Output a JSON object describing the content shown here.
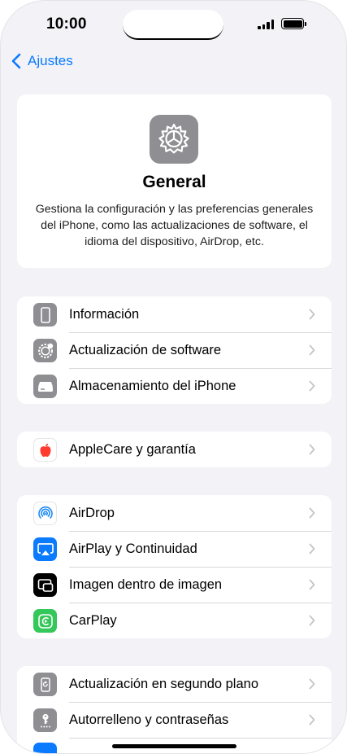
{
  "status_bar": {
    "time": "10:00"
  },
  "nav": {
    "back_label": "Ajustes"
  },
  "header": {
    "title": "General",
    "description": "Gestiona la configuración y las preferencias generales del iPhone, como las actualizaciones de software, el idioma del dispositivo, AirDrop, etc."
  },
  "groups": [
    {
      "items": [
        {
          "label": "Información",
          "icon": "phone-info-icon"
        },
        {
          "label": "Actualización de software",
          "icon": "software-update-gear-icon"
        },
        {
          "label": "Almacenamiento del iPhone",
          "icon": "storage-drive-icon"
        }
      ]
    },
    {
      "items": [
        {
          "label": "AppleCare y garantía",
          "icon": "apple-logo-icon"
        }
      ]
    },
    {
      "items": [
        {
          "label": "AirDrop",
          "icon": "airdrop-icon"
        },
        {
          "label": "AirPlay y Continuidad",
          "icon": "airplay-icon"
        },
        {
          "label": "Imagen dentro de imagen",
          "icon": "picture-in-picture-icon"
        },
        {
          "label": "CarPlay",
          "icon": "carplay-icon"
        }
      ]
    },
    {
      "items": [
        {
          "label": "Actualización en segundo plano",
          "icon": "background-refresh-icon"
        },
        {
          "label": "Autorrelleno y contraseñas",
          "icon": "key-autofill-icon"
        }
      ]
    }
  ],
  "colors": {
    "accent": "#0a7aff",
    "background": "#f2f2f7",
    "icon_gray": "#8e8e93",
    "airdrop_blue": "#1e8cf5",
    "carplay_green": "#34c759",
    "apple_red": "#ff3b30"
  }
}
